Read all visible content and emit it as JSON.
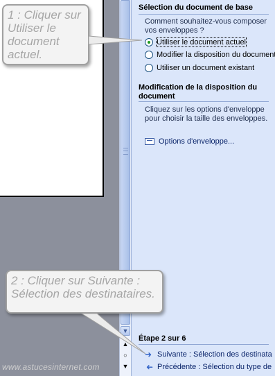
{
  "pane": {
    "section1_title": "Sélection du document de base",
    "section1_question": "Comment souhaitez-vous composer vos enveloppes ?",
    "options": [
      {
        "label": "Utiliser le document actuel",
        "selected": true
      },
      {
        "label": "Modifier la disposition du document",
        "selected": false
      },
      {
        "label": "Utiliser un document existant",
        "selected": false
      }
    ],
    "section2_title": "Modification de la disposition du document",
    "section2_text": "Cliquez sur les options d'enveloppe pour choisir la taille des enveloppes.",
    "envelope_options_link": "Options d'enveloppe...",
    "step_title": "Étape 2 sur 6",
    "next_link": "Suivante : Sélection des destinata",
    "prev_link": "Précédente : Sélection du type de"
  },
  "callouts": {
    "c1": "1 : Cliquer sur Utiliser le document actuel.",
    "c2": "2 : Cliquer sur Suivante : Sélection des destinataires."
  },
  "watermark": "www.astucesinternet.com",
  "icons": {
    "radio": "radio-button-icon",
    "envelope": "envelope-icon",
    "next": "arrow-right-icon",
    "prev": "arrow-left-icon",
    "scroll_down": "chevron-down-icon",
    "prev_page": "double-chevron-up-icon",
    "select_browse": "circle-icon",
    "next_page": "double-chevron-down-icon"
  },
  "colors": {
    "pane_bg": "#dbe6fa",
    "link": "#0a246a",
    "radio_selected": "#1f9a1f"
  }
}
